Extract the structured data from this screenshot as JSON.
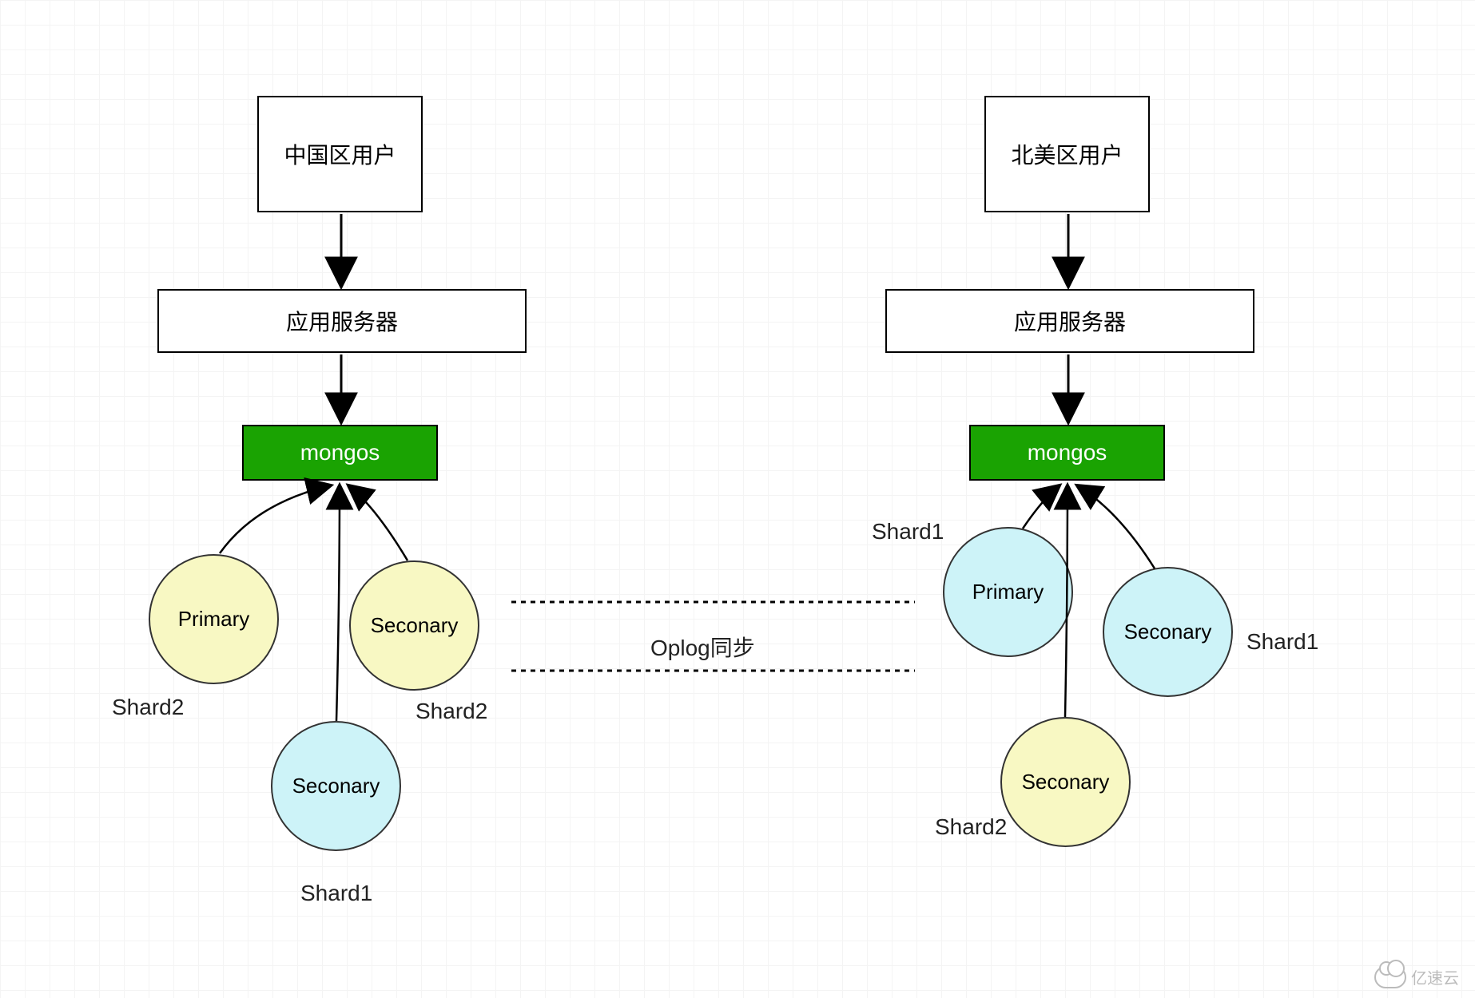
{
  "left": {
    "user_label": "中国区用户",
    "app_server_label": "应用服务器",
    "mongos_label": "mongos",
    "primary": "Primary",
    "secondary_right": "Seconary",
    "secondary_bottom": "Seconary",
    "shard_primary": "Shard2",
    "shard_secondary_right": "Shard2",
    "shard_secondary_bottom": "Shard1"
  },
  "right": {
    "user_label": "北美区用户",
    "app_server_label": "应用服务器",
    "mongos_label": "mongos",
    "primary": "Primary",
    "secondary_right": "Seconary",
    "secondary_bottom": "Seconary",
    "shard_primary": "Shard1",
    "shard_secondary_right": "Shard1",
    "shard_secondary_bottom": "Shard2"
  },
  "center": {
    "oplog_label": "Oplog同步"
  },
  "watermark": "亿速云",
  "colors": {
    "mongos_bg": "#1aa302",
    "yellow_node": "#f8f8c3",
    "blue_node": "#cdf3f8",
    "border": "#000000"
  }
}
